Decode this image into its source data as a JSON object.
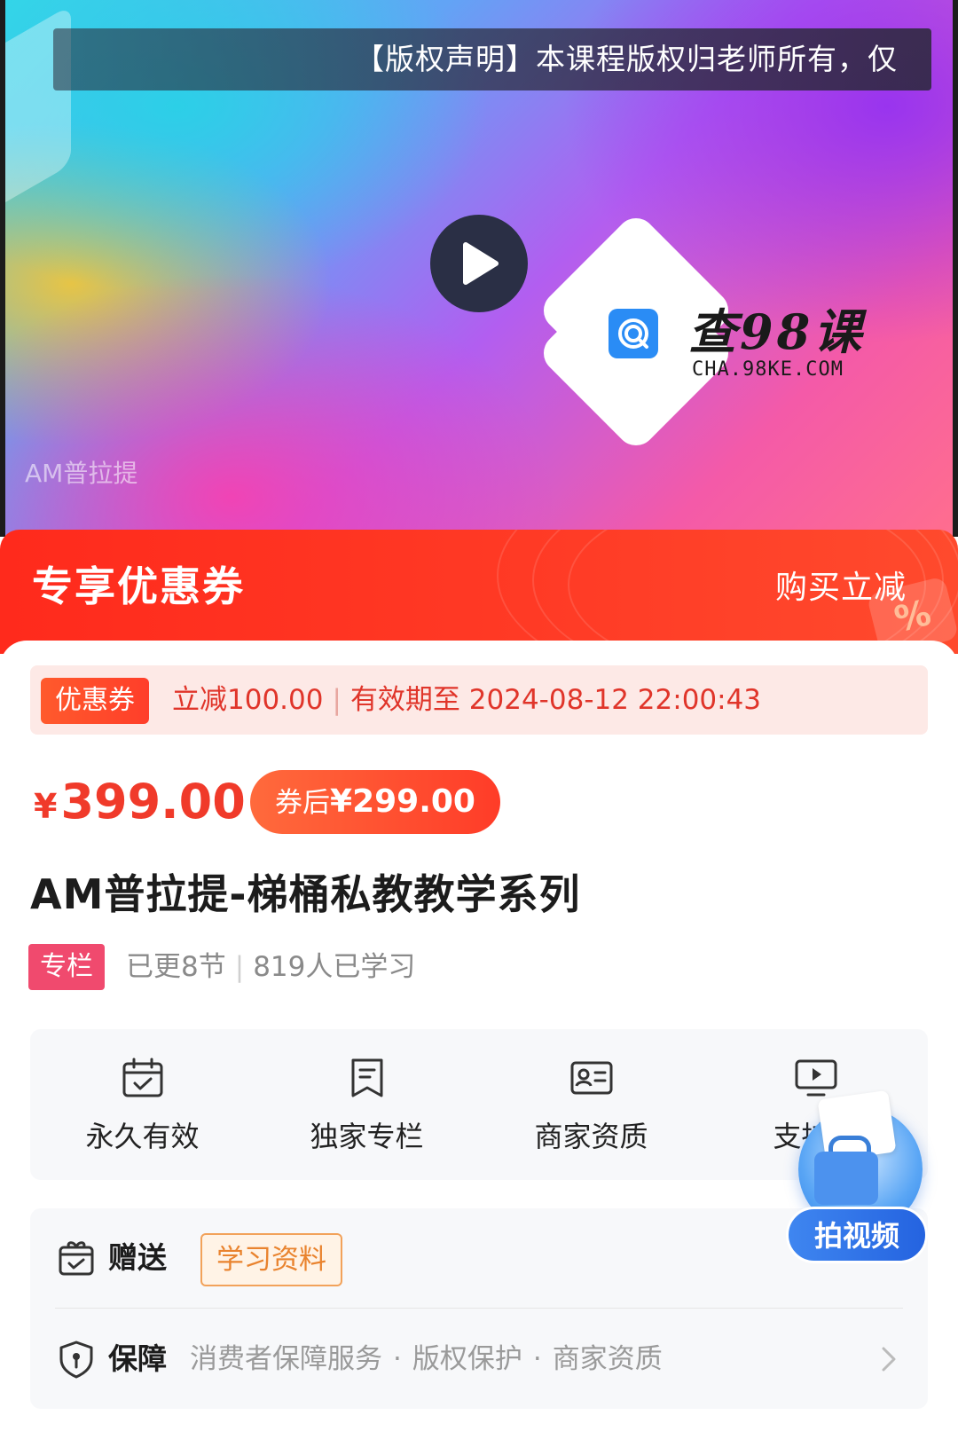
{
  "video": {
    "copyright_notice": "【版权声明】本课程版权归老师所有，仅",
    "caption": "AM普拉提",
    "watermark_brand": "查98课",
    "watermark_url": "CHA.98KE.COM"
  },
  "coupon_banner": {
    "title": "专享优惠券",
    "right_label": "购买立减",
    "decoration": "%"
  },
  "coupon": {
    "tag": "优惠券",
    "discount": "立减100.00",
    "validity": "有效期至 2024-08-12 22:00:43"
  },
  "pricing": {
    "currency": "¥",
    "price": "399.00",
    "after_label": "券后",
    "after_price": "¥299.00"
  },
  "course": {
    "title": "AM普拉提-梯桶私教教学系列",
    "tag": "专栏",
    "updated": "已更8节",
    "learners": "819人已学习"
  },
  "features": [
    {
      "label": "永久有效",
      "icon": "calendar-check-icon"
    },
    {
      "label": "独家专栏",
      "icon": "bookmark-icon"
    },
    {
      "label": "商家资质",
      "icon": "id-card-icon"
    },
    {
      "label": "支持电",
      "icon": "tv-play-icon"
    }
  ],
  "gift": {
    "label": "赠送",
    "item": "学习资料",
    "icon": "gift-calendar-icon"
  },
  "guarantee": {
    "label": "保障",
    "items": [
      "消费者保障服务",
      "版权保护",
      "商家资质"
    ],
    "separator": "·",
    "icon": "shield-icon"
  },
  "floating_button": {
    "label": "拍视频"
  },
  "colors": {
    "brand_red": "#ff2a1c",
    "price_red": "#f03a2a",
    "tag_pink": "#f04a6e",
    "gift_orange": "#e9832e",
    "fab_blue": "#2463e0"
  }
}
